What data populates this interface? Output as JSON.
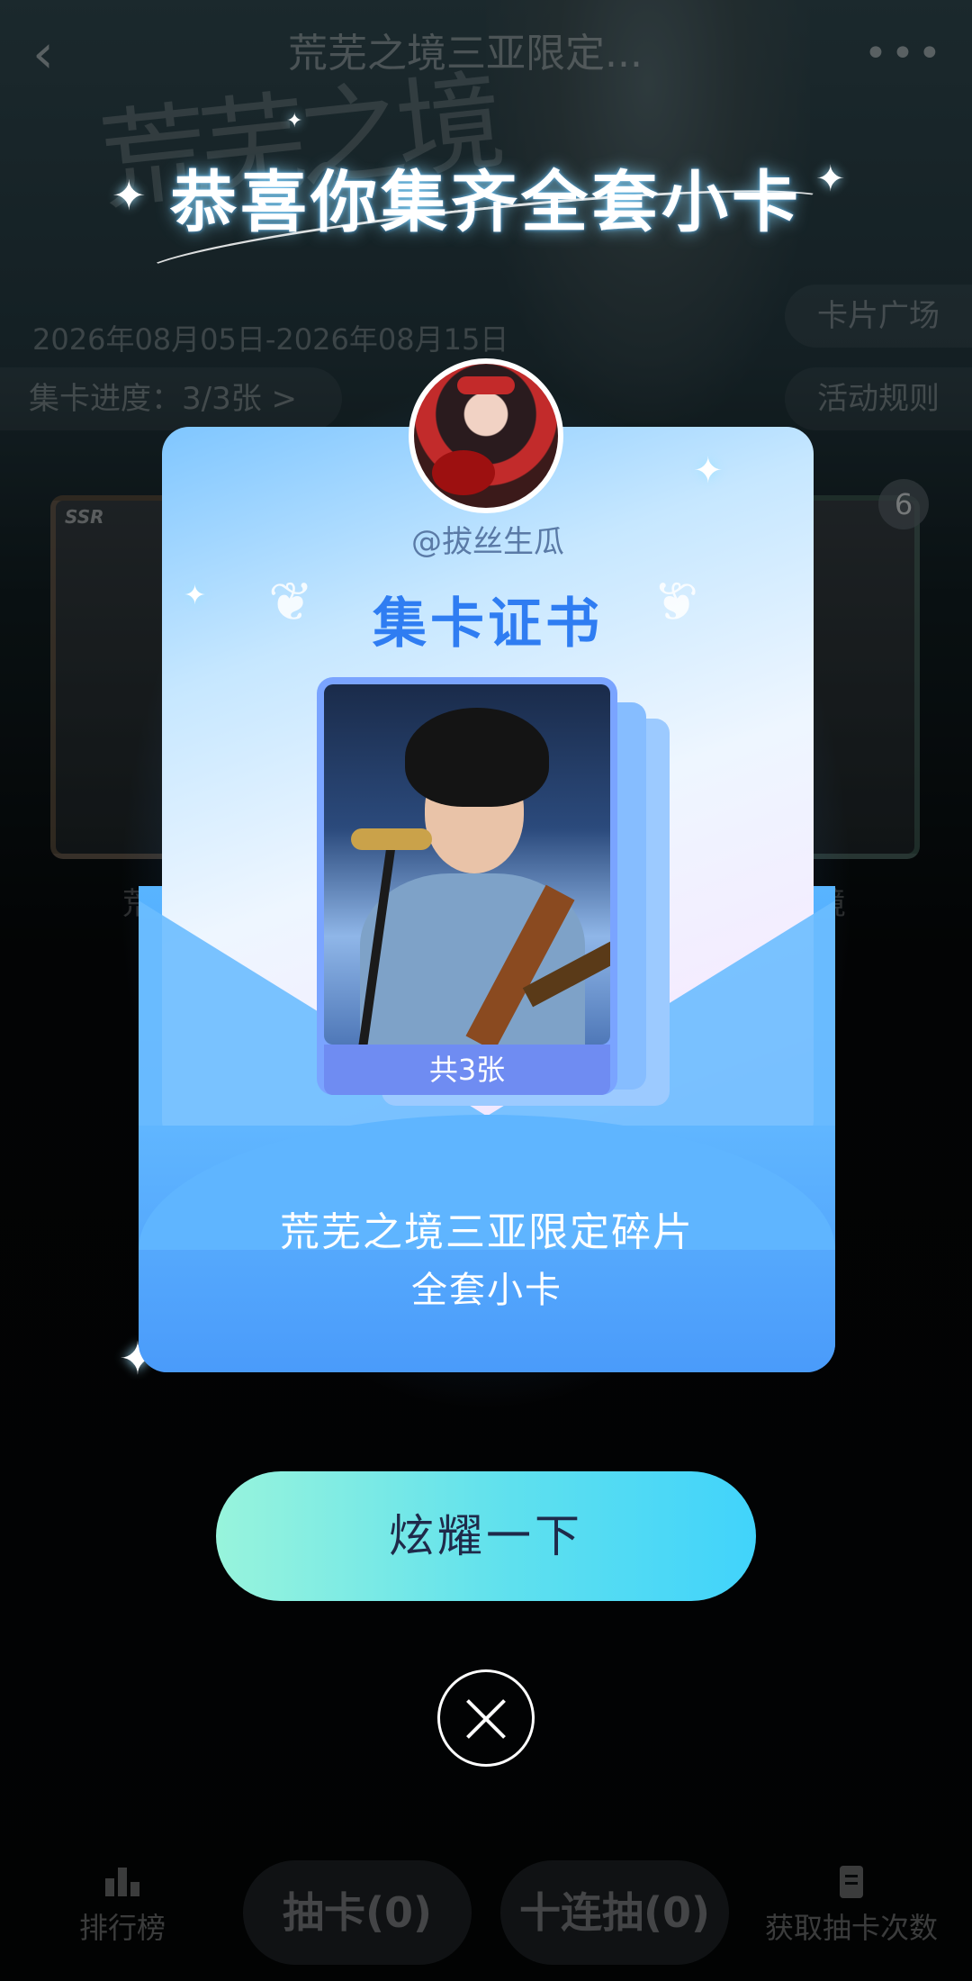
{
  "header": {
    "back_icon": "chevron-left-icon",
    "title": "荒芜之境三亚限定...",
    "more_icon": "more-dots-icon"
  },
  "background": {
    "calligraphy": "荒芜之境",
    "date_range": "2026年08月05日-2026年08月15日",
    "progress": "集卡进度：3/3张 >",
    "card_plaza": "卡片广场",
    "activity_rules": "活动规则",
    "card_left_label": "荒",
    "card_right_label": "境",
    "ssr_badge": "SSR",
    "count_badge": "6"
  },
  "modal": {
    "congrats": "恭喜你集齐全套小卡",
    "username": "@拔丝生瓜",
    "certificate_title": "集卡证书",
    "card_count": "共3张",
    "collection_name": "荒芜之境三亚限定碎片",
    "collection_sub": "全套小卡",
    "show_button": "炫耀一下",
    "close_icon": "close-icon"
  },
  "bottom_bar": {
    "ranking": "排行榜",
    "draw": "抽卡(0)",
    "ten_draw": "十连抽(0)",
    "get_draws": "获取抽卡次数"
  },
  "colors": {
    "accent_blue": "#2f7df2",
    "button_start": "#98f4dc",
    "button_end": "#41d3fb"
  }
}
